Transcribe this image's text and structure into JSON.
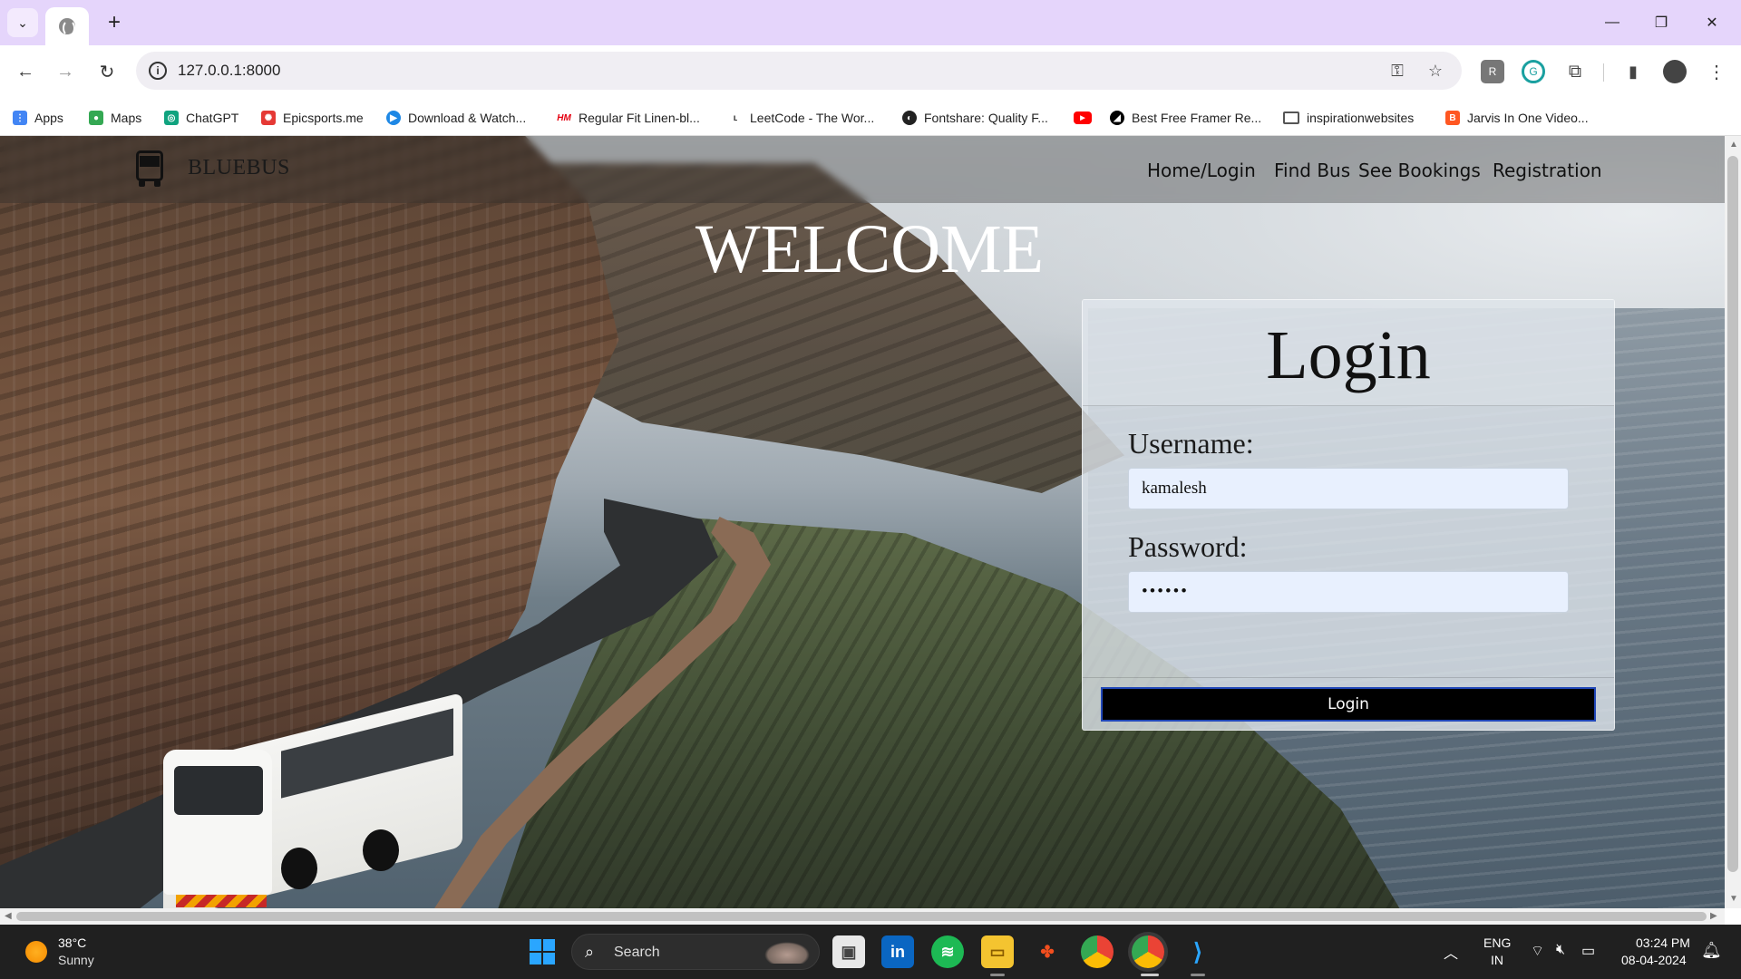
{
  "browser": {
    "address_url": "127.0.0.1:8000",
    "bookmarks": [
      {
        "label": "Apps",
        "icon": "apps-grid-icon",
        "color": "#4285f4"
      },
      {
        "label": "Maps",
        "icon": "maps-pin-icon",
        "color": "#34a853"
      },
      {
        "label": "ChatGPT",
        "icon": "chatgpt-icon",
        "color": "#10a37f"
      },
      {
        "label": "Epicsports.me",
        "icon": "epicsports-icon",
        "color": "#e53935"
      },
      {
        "label": "Download & Watch...",
        "icon": "play-icon",
        "color": "#1e88e5"
      },
      {
        "label": "Regular Fit Linen-bl...",
        "icon": "hm-icon",
        "color": "#e50010"
      },
      {
        "label": "LeetCode - The Wor...",
        "icon": "leetcode-icon",
        "color": "#f89f1b"
      },
      {
        "label": "Fontshare: Quality F...",
        "icon": "fontshare-icon",
        "color": "#222222"
      },
      {
        "label": "",
        "icon": "youtube-icon",
        "color": "#ff0000"
      },
      {
        "label": "Best Free Framer Re...",
        "icon": "framer-icon",
        "color": "#000000"
      },
      {
        "label": "inspirationwebsites",
        "icon": "folder-icon",
        "color": "#555555"
      },
      {
        "label": "Jarvis In One Video...",
        "icon": "blogger-icon",
        "color": "#ff5722"
      }
    ]
  },
  "site": {
    "brand": "BLUEBUS",
    "nav": [
      "Home/Login",
      "Find Bus",
      "See Bookings",
      "Registration"
    ],
    "welcome": "WELCOME",
    "login": {
      "title": "Login",
      "username_label": "Username:",
      "username_value": "kamalesh",
      "password_label": "Password:",
      "password_value": "••••••",
      "button": "Login"
    }
  },
  "taskbar": {
    "temperature": "38°C",
    "condition": "Sunny",
    "search_label": "Search",
    "lang_top": "ENG",
    "lang_bottom": "IN",
    "time": "03:24 PM",
    "date": "08-04-2024"
  }
}
